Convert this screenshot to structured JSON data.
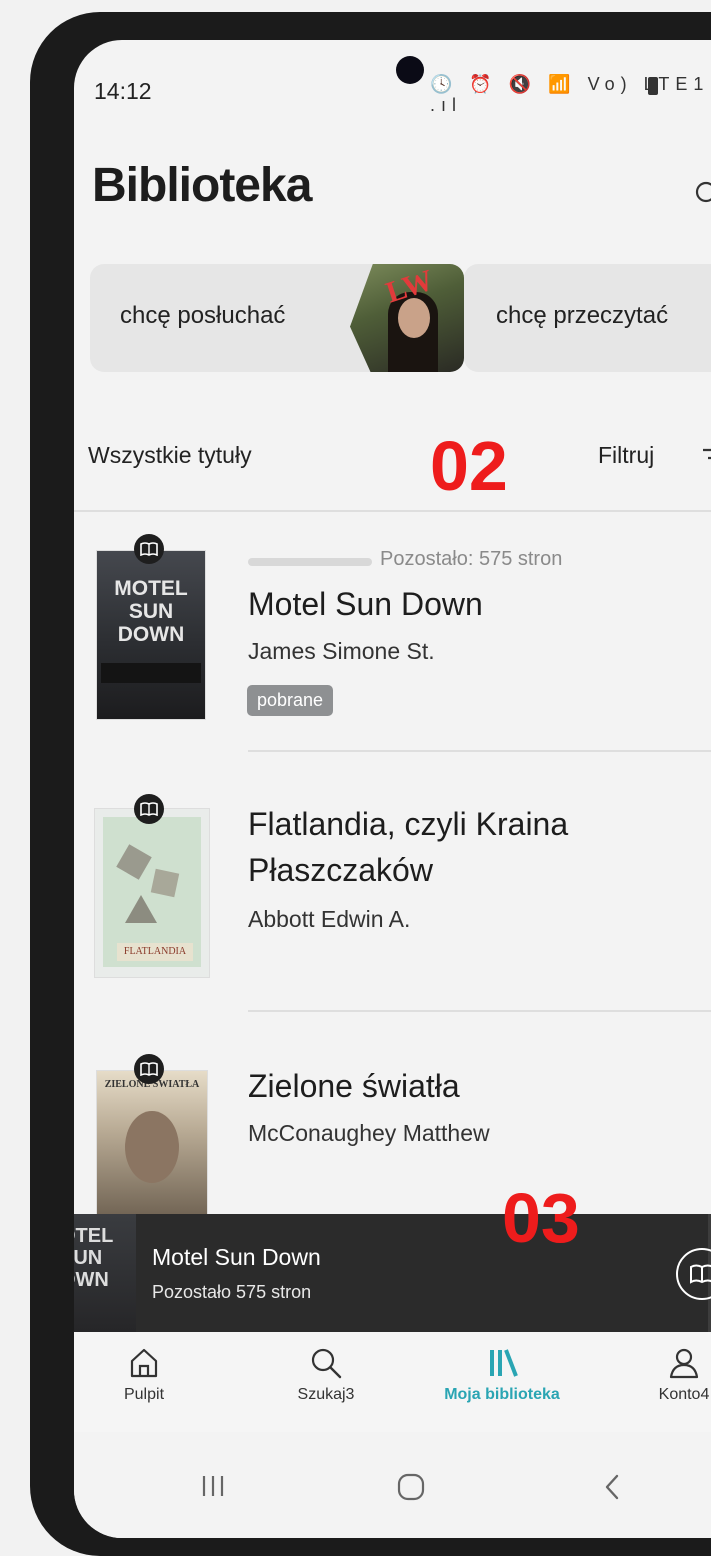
{
  "status_bar": {
    "time": "14:12",
    "icons": "🕓 ⏰ 🔇 📶 Vo) LTE1 .ıl"
  },
  "header": {
    "title": "Biblioteka"
  },
  "shelves": [
    {
      "label": "chcę posłuchać",
      "cover_text": "LW"
    },
    {
      "label": "chcę przeczytać"
    }
  ],
  "filter_row": {
    "all_titles": "Wszystkie tytuły",
    "filter": "Filtruj"
  },
  "overlays": {
    "step_2": "02",
    "step_3": "03"
  },
  "books": [
    {
      "cover_text": "MOTEL SUN DOWN",
      "progress_text": "Pozostało: 575 stron",
      "progress_fraction": 0.0,
      "title": "Motel Sun Down",
      "author": "James Simone St.",
      "badge": "pobrane"
    },
    {
      "cover_text": "FLATLANDIA",
      "title_line1": "Flatlandia, czyli Kraina",
      "title_line2": "Płaszczaków",
      "author": "Abbott Edwin A."
    },
    {
      "cover_text": "ZIELONE ŚWIATŁA",
      "title": "Zielone światła",
      "author": "McConaughey Matthew"
    }
  ],
  "mini_player": {
    "cover_text_1": "OTEL",
    "cover_text_2": "SUN",
    "cover_text_3": "OWN",
    "title": "Motel Sun Down",
    "subtitle": "Pozostało 575 stron"
  },
  "bottom_nav": [
    {
      "label": "Pulpit",
      "icon": "home-icon",
      "active": false
    },
    {
      "label": "Szukaj3",
      "icon": "search-icon",
      "active": false
    },
    {
      "label": "Moja biblioteka",
      "icon": "library-icon",
      "active": true
    },
    {
      "label": "Konto4",
      "icon": "account-icon",
      "active": false
    }
  ],
  "colors": {
    "accent": "#2aa5b3",
    "overlay_red": "#ee1c1c",
    "player_bg": "#2b2b2b",
    "badge_bg": "#8e9092"
  }
}
